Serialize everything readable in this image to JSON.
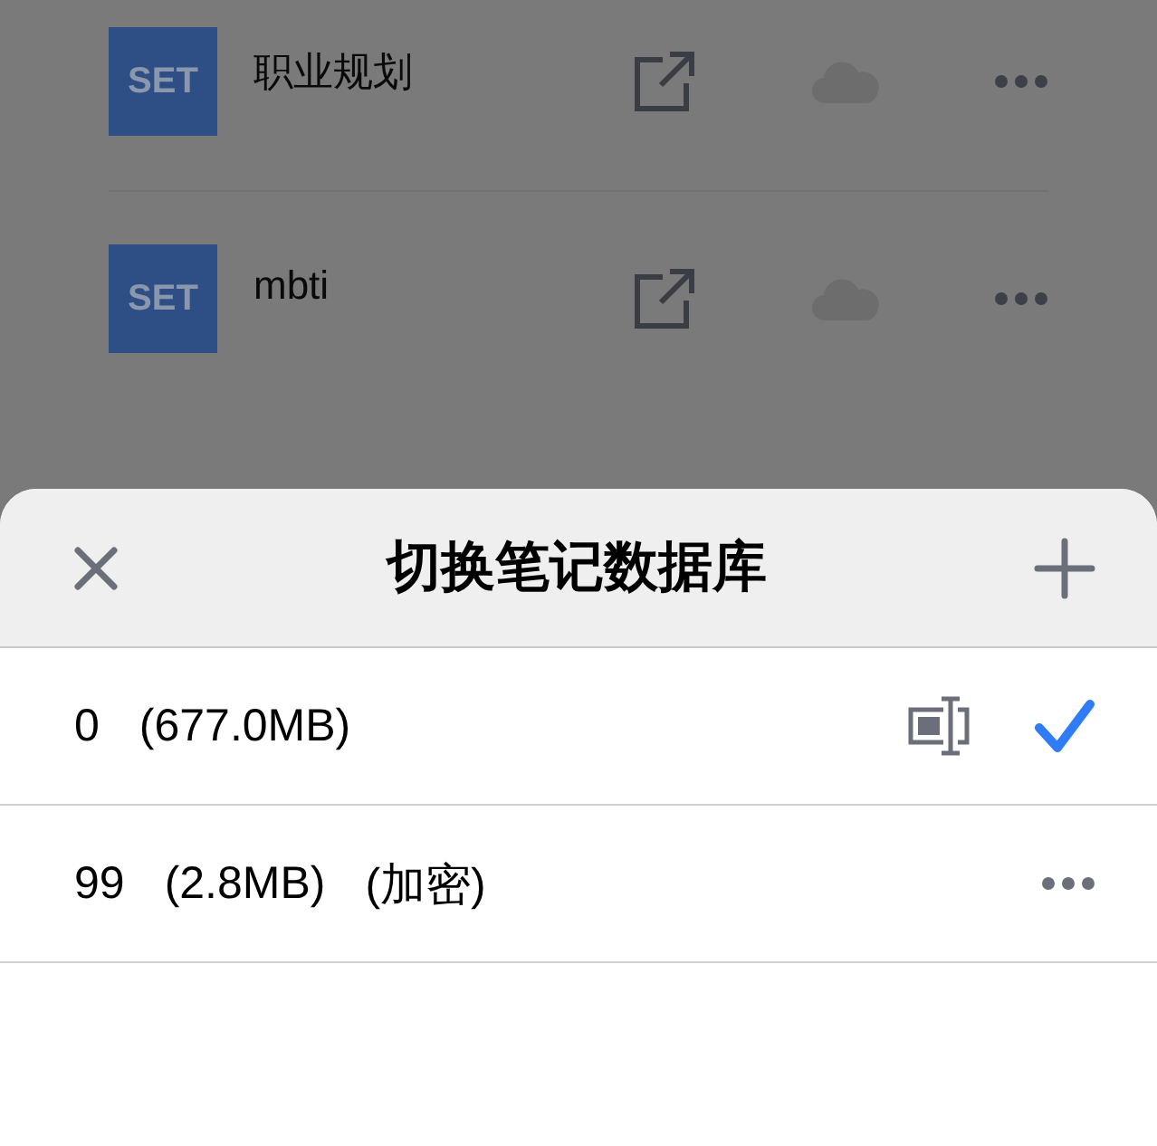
{
  "notes": [
    {
      "badge": "SET",
      "title": "职业规划"
    },
    {
      "badge": "SET",
      "title": "mbti"
    }
  ],
  "sheet": {
    "title": "切换笔记数据库",
    "databases": [
      {
        "name": "0",
        "size": "(677.0MB)",
        "selected": true
      },
      {
        "name": "99",
        "size": "(2.8MB)",
        "note": "(加密)",
        "selected": false
      }
    ]
  }
}
